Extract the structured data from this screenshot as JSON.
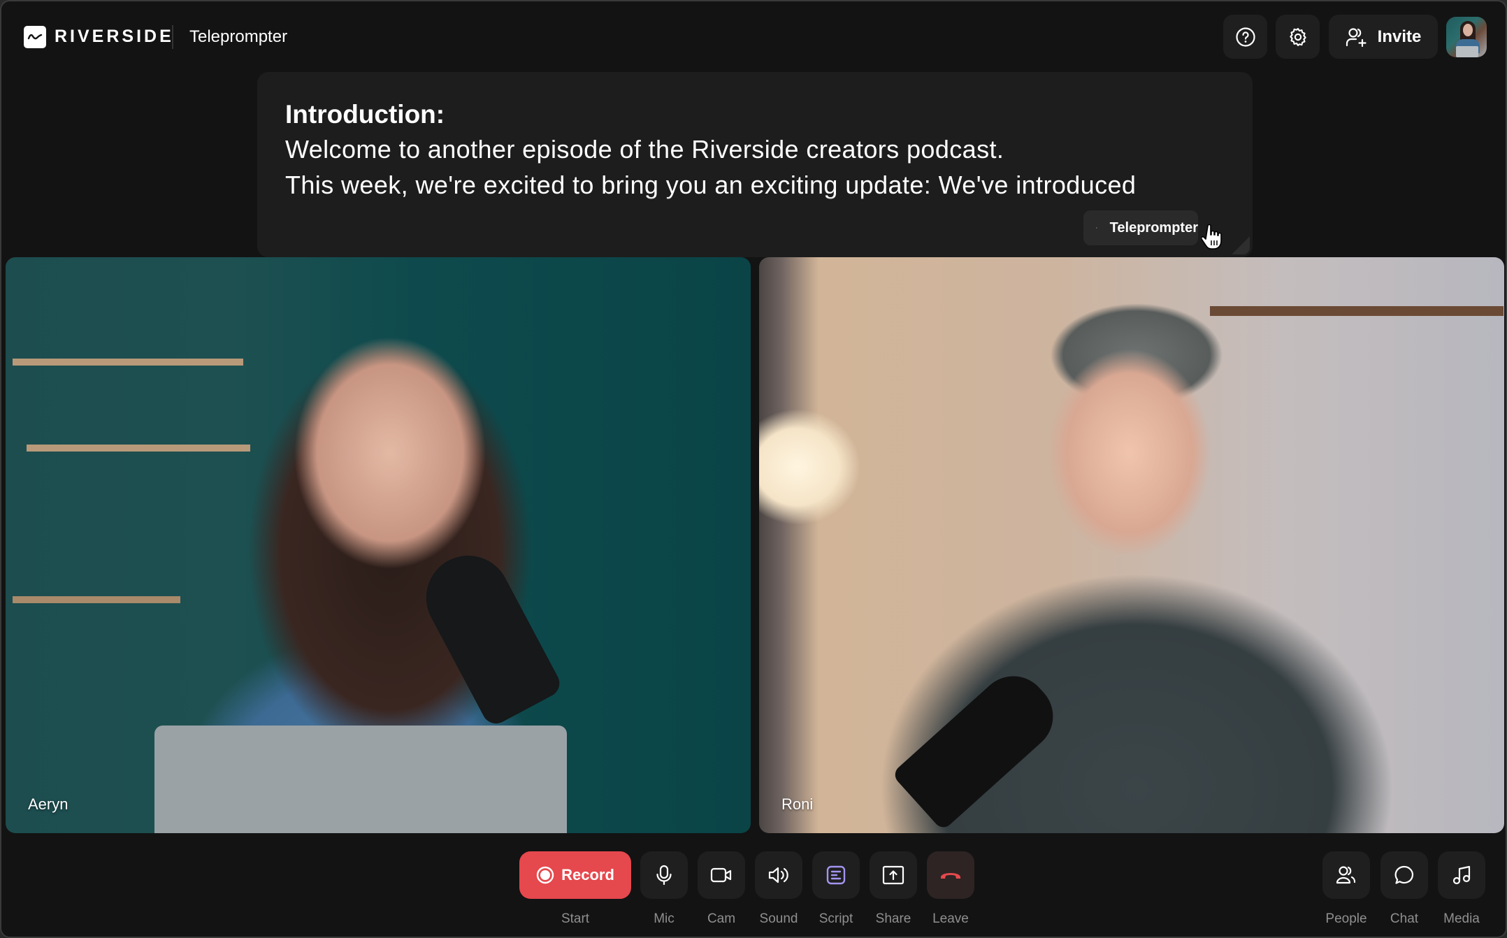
{
  "app": {
    "brand": "RIVERSIDE",
    "page_title": "Teleprompter"
  },
  "header": {
    "help_icon": "help-circle-icon",
    "settings_icon": "gear-icon",
    "invite_label": "Invite",
    "invite_icon": "user-plus-icon",
    "avatar_alt": "Current user avatar"
  },
  "teleprompter": {
    "heading": "Introduction:",
    "lines": [
      "Welcome to another episode of the Riverside creators podcast.",
      "This week, we're excited to bring you an exciting update: We've introduced"
    ],
    "button_label": "Teleprompter",
    "button_icon": "play-square-icon"
  },
  "participants": [
    {
      "name": "Aeryn"
    },
    {
      "name": "Roni"
    }
  ],
  "toolbar": {
    "main": [
      {
        "id": "record",
        "label": "Start",
        "button_text": "Record",
        "icon": "record-icon"
      },
      {
        "id": "mic",
        "label": "Mic",
        "icon": "microphone-icon"
      },
      {
        "id": "cam",
        "label": "Cam",
        "icon": "camera-icon"
      },
      {
        "id": "sound",
        "label": "Sound",
        "icon": "speaker-icon"
      },
      {
        "id": "script",
        "label": "Script",
        "icon": "script-icon"
      },
      {
        "id": "share",
        "label": "Share",
        "icon": "share-screen-icon"
      },
      {
        "id": "leave",
        "label": "Leave",
        "icon": "hang-up-icon"
      }
    ],
    "side": [
      {
        "id": "people",
        "label": "People",
        "icon": "people-icon"
      },
      {
        "id": "chat",
        "label": "Chat",
        "icon": "chat-bubble-icon"
      },
      {
        "id": "media",
        "label": "Media",
        "icon": "music-note-icon"
      }
    ]
  },
  "colors": {
    "record": "#e5484d",
    "script_accent": "#a394f0",
    "leave_accent": "#e5484d",
    "background": "#131313",
    "panel": "#1f1f1f"
  }
}
